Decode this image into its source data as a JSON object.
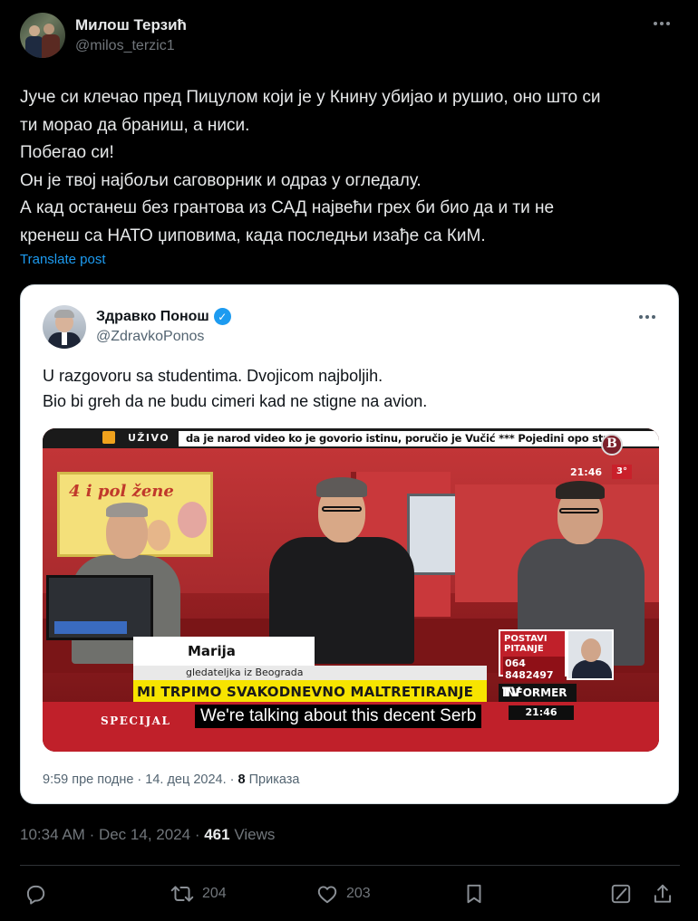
{
  "post": {
    "author_name": "Милош Терзић",
    "author_handle": "@milos_terzic1",
    "text_lines": [
      "Јуче си клечао пред Пицулом који је у Книну убијао и рушио, оно што си",
      "ти морао да браниш, а ниси.",
      "Побегао си!",
      "Он је твој најбољи саговорник и одраз у огледалу.",
      "А кад останеш без грантова из САД највећи грех би био да и ти не",
      "кренеш са НАТО џиповима, када последњи изађе са КиМ."
    ],
    "translate_label": "Translate post",
    "time": "10:34 AM",
    "date": "Dec 14, 2024",
    "views_count": "461",
    "views_label": "Views"
  },
  "quoted": {
    "author_name": "Здравко Понош",
    "author_handle": "@ZdravkoPonos",
    "verified_icon": "verified-badge-icon",
    "text_lines": [
      "U razgovoru sa studentima. Dvojicom najboljih.",
      "Bio bi greh da ne budu cimeri kad ne stigne na avion."
    ],
    "footer_time": "9:59 пре подне",
    "footer_date": "14. дец 2024.",
    "footer_views_count": "8",
    "footer_views_label": "Приказа",
    "video": {
      "live_label": "UŽIVO",
      "ticker_text": "da je narod video ko je govorio  istinu, poručio je Vučić *** Pojedini opo        stre",
      "clock": "21:46",
      "temperature": "3°",
      "poster_text": "4 i pol žene",
      "caller_name": "Marija",
      "caller_subtitle": "gledateljka iz Beograda",
      "headline": "MI TRPIMO SVAKODNEVNO MALTRETIRANJE",
      "segment_label": "SPECIJAL",
      "caption": "We're talking about this decent Serb",
      "channel_label": "INFORMER",
      "channel_tv": "TV",
      "lower_clock": "21:46",
      "postavi_label": "POSTAVI PITANJE",
      "phone_number": "064 8482497",
      "corner_badge": "B"
    }
  },
  "actions": {
    "reply_icon": "reply-icon",
    "repost_icon": "repost-icon",
    "repost_count": "204",
    "like_icon": "like-icon",
    "like_count": "203",
    "bookmark_icon": "bookmark-icon",
    "grok_icon": "grok-icon",
    "share_icon": "share-icon"
  },
  "colors": {
    "background": "#000000",
    "link": "#1d9bf0",
    "muted": "#71767b",
    "card_bg": "#ffffff"
  }
}
